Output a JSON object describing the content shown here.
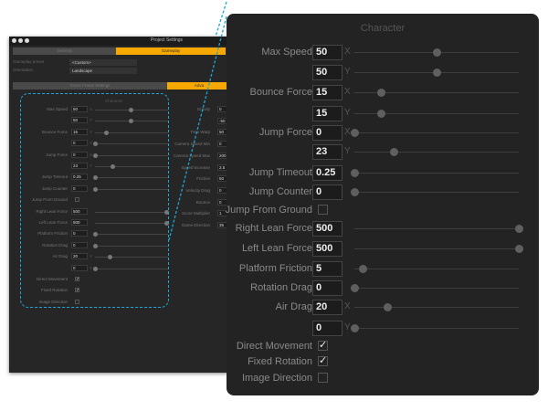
{
  "window": {
    "title": "Project Settings",
    "tabs": [
      "General",
      "Gameplay"
    ],
    "active_tab": 1,
    "preset_label": "Gameplay preset",
    "preset_value": "<Custom>",
    "orientation_label": "Orientation",
    "orientation_value": "Landscape",
    "subtabs": [
      "Game Frame Settings",
      "Adva"
    ],
    "active_subtab": 1,
    "character_title": "Character",
    "rows": [
      {
        "label": "Max Speed",
        "value": "50",
        "axis": "X",
        "slider": 0.5
      },
      {
        "label": "",
        "value": "50",
        "axis": "Y",
        "slider": 0.5
      },
      {
        "label": "Bounce Force",
        "value": "15",
        "axis": "X",
        "slider": 0.16
      },
      {
        "label": "",
        "value": "0",
        "axis": "Y",
        "slider": 0
      },
      {
        "label": "Jump Force",
        "value": "0",
        "axis": "X",
        "slider": 0
      },
      {
        "label": "",
        "value": "23",
        "axis": "Y",
        "slider": 0.24
      },
      {
        "label": "Jump Timeout",
        "value": "0.25",
        "axis": "",
        "slider": 0
      },
      {
        "label": "Jump Counter",
        "value": "0",
        "axis": "",
        "slider": 0
      },
      {
        "label": "Jump From Ground",
        "check": false
      },
      {
        "label": "Right Lean Force",
        "value": "500",
        "axis": "",
        "slider": 1
      },
      {
        "label": "Left Lean Force",
        "value": "500",
        "axis": "",
        "slider": 1
      },
      {
        "label": "Platform Friction",
        "value": "0",
        "axis": "",
        "slider": 0
      },
      {
        "label": "Rotation Drag",
        "value": "0",
        "axis": "",
        "slider": 0
      },
      {
        "label": "Air Drag",
        "value": "20",
        "axis": "X",
        "slider": 0.2
      },
      {
        "label": "",
        "value": "0",
        "axis": "Y",
        "slider": 0
      },
      {
        "label": "Direct Movement",
        "check": true
      },
      {
        "label": "Fixed Rotation",
        "check": true
      },
      {
        "label": "Image Direction",
        "check": false
      }
    ],
    "right_rows": [
      {
        "label": "Gravity",
        "value": "0"
      },
      {
        "label": "",
        "value": "-50"
      },
      {
        "label": "Time Warp",
        "value": "50"
      },
      {
        "label": "Camera Speed Min",
        "value": "0"
      },
      {
        "label": "Camera Speed Max",
        "value": "200"
      },
      {
        "label": "Speed Increase",
        "value": "2.5"
      },
      {
        "label": "Friction",
        "value": "50"
      },
      {
        "label": "Velocity Drag",
        "value": "0"
      },
      {
        "label": "Bounce",
        "value": "0"
      },
      {
        "label": "Score Multiplier",
        "value": "1"
      },
      {
        "label": "Game Direction",
        "value": "35"
      }
    ]
  },
  "panel": {
    "title": "Character",
    "rows": [
      {
        "label": "Max Speed",
        "value": "50",
        "axis": "X",
        "slider": 0.5
      },
      {
        "label": "",
        "value": "50",
        "axis": "Y",
        "slider": 0.5
      },
      {
        "label": "Bounce Force",
        "value": "15",
        "axis": "X",
        "slider": 0.16
      },
      {
        "label": "",
        "value": "15",
        "axis": "Y",
        "slider": 0.16
      },
      {
        "label": "Jump Force",
        "value": "0",
        "axis": "X",
        "slider": 0
      },
      {
        "label": "",
        "value": "23",
        "axis": "Y",
        "slider": 0.24
      },
      {
        "label": "Jump Timeout",
        "value": "0.25",
        "axis": "",
        "slider": 0
      },
      {
        "label": "Jump Counter",
        "value": "0",
        "axis": "",
        "slider": 0
      },
      {
        "label": "Jump From Ground",
        "check": false
      },
      {
        "label": "Right Lean Force",
        "value": "500",
        "axis": "",
        "slider": 1
      },
      {
        "label": "Left Lean Force",
        "value": "500",
        "axis": "",
        "slider": 1
      },
      {
        "label": "Platform Friction",
        "value": "5",
        "axis": "",
        "slider": 0.05
      },
      {
        "label": "Rotation Drag",
        "value": "0",
        "axis": "",
        "slider": 0
      },
      {
        "label": "Air Drag",
        "value": "20",
        "axis": "X",
        "slider": 0.2
      },
      {
        "label": "",
        "value": "0",
        "axis": "Y",
        "slider": 0
      },
      {
        "label": "Direct Movement",
        "check": true
      },
      {
        "label": "Fixed Rotation",
        "check": true
      },
      {
        "label": "Image Direction",
        "check": false
      }
    ]
  },
  "colors": {
    "accent": "#f6a800",
    "callout": "#1aa6d6",
    "panel": "#232323"
  }
}
